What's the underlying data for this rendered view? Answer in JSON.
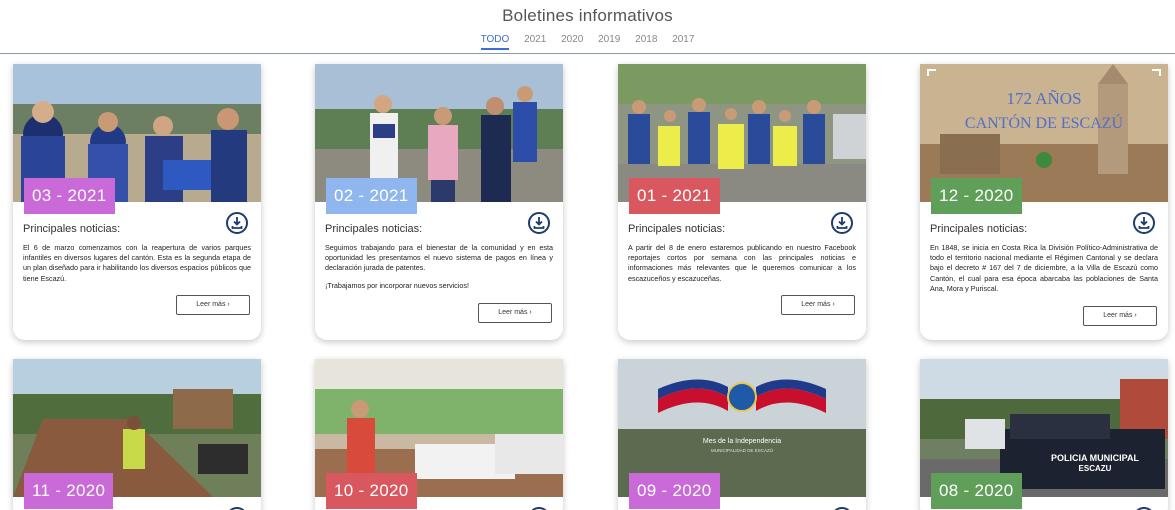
{
  "header": {
    "title": "Boletines informativos",
    "tabs": [
      "TODO",
      "2021",
      "2020",
      "2019",
      "2018",
      "2017"
    ],
    "active_tab": "TODO"
  },
  "cards": [
    {
      "month": "03 - 2021",
      "badge_color": "#c96ad8",
      "heading": "Principales noticias:",
      "paragraphs": [
        "El 6 de marzo comenzamos con la reapertura de varios parques infantiles en diversos lugares del cantón. Esta es la segunda etapa de un plan diseñado para ir habilitando los diversos espacios públicos que tiene Escazú."
      ],
      "button": "Leer más ›"
    },
    {
      "month": "02 - 2021",
      "badge_color": "#8fb6ee",
      "heading": "Principales noticias:",
      "paragraphs": [
        "Seguimos trabajando para el bienestar de la comunidad y en esta oportunidad les presentamos el nuevo sistema de pagos en línea y declaración jurada de patentes.",
        "¡Trabajamos por incorporar nuevos servicios!"
      ],
      "button": "Leer más ›"
    },
    {
      "month": "01 - 2021",
      "badge_color": "#d9575f",
      "heading": "Principales noticias:",
      "paragraphs": [
        "A partir del 8 de enero estaremos publicando en nuestro Facebook reportajes cortos por semana con las principales noticias e informaciones más relevantes que le queremos comunicar a los escazuceños y escazuceñas."
      ],
      "button": "Leer más ›"
    },
    {
      "month": "12 - 2020",
      "badge_color": "#5f9f59",
      "heading": "Principales noticias:",
      "paragraphs": [
        "En 1848, se inicia en Costa Rica la División Político-Administrativa de todo el territorio nacional mediante el Régimen Cantonal y se declara bajo el decreto # 167 del 7 de diciembre, a la Villa de Escazú como Cantón, el cual para esa época abarcaba las poblaciones de Santa Ana, Mora y Puriscal."
      ],
      "button": "Leer más ›",
      "image_overlay": [
        "172 AÑOS",
        "CANTÓN DE ESCAZÚ"
      ]
    },
    {
      "month": "11 - 2020",
      "badge_color": "#c96ad8"
    },
    {
      "month": "10 - 2020",
      "badge_color": "#d9575f"
    },
    {
      "month": "09 - 2020",
      "badge_color": "#c96ad8",
      "image_overlay": [
        "Mes de la Independencia",
        "MUNICIPALIDAD DE ESCAZÚ"
      ]
    },
    {
      "month": "08 - 2020",
      "badge_color": "#5f9f59",
      "image_overlay": [
        "POLICIA MUNICIPAL",
        "ESCAZU"
      ]
    }
  ]
}
